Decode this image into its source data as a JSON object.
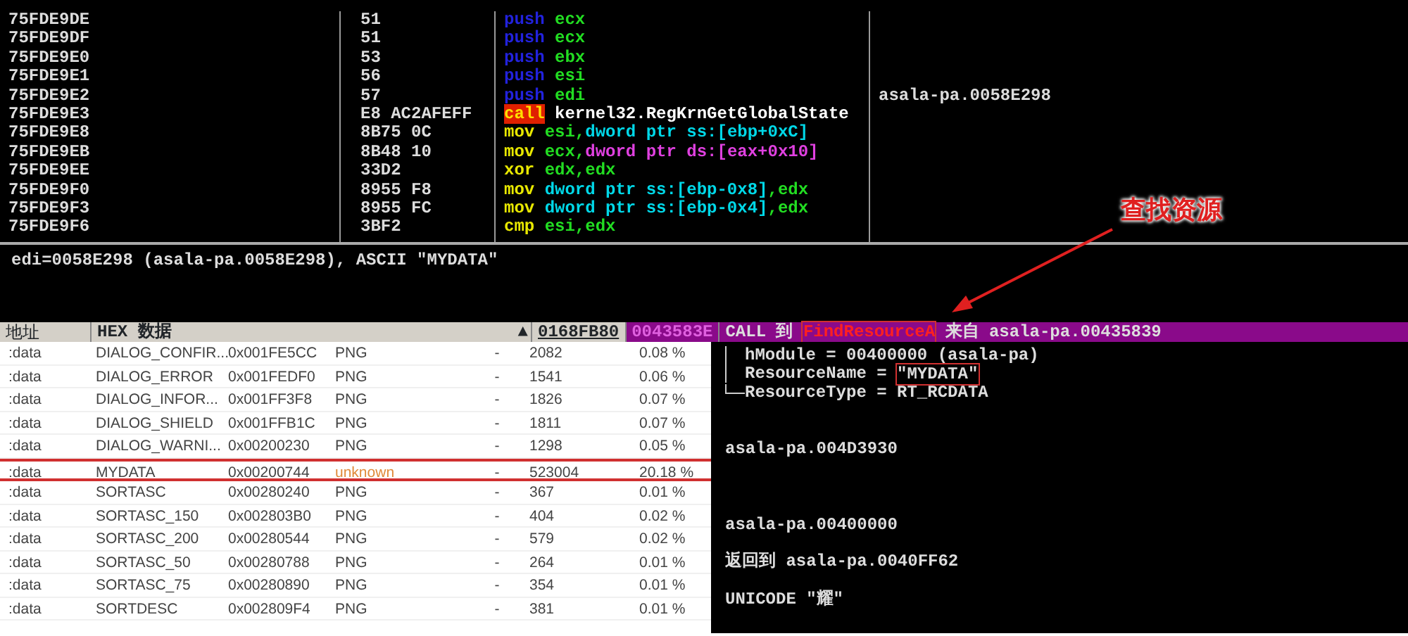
{
  "disassembly": [
    {
      "address": "75FDE9DE",
      "hex": "51",
      "mnemonic": {
        "text": "push",
        "kind": "push"
      },
      "operands": [
        {
          "text": "ecx",
          "kind": "reg"
        }
      ]
    },
    {
      "address": "75FDE9DF",
      "hex": "51",
      "mnemonic": {
        "text": "push",
        "kind": "push"
      },
      "operands": [
        {
          "text": "ecx",
          "kind": "reg"
        }
      ]
    },
    {
      "address": "75FDE9E0",
      "hex": "53",
      "mnemonic": {
        "text": "push",
        "kind": "push"
      },
      "operands": [
        {
          "text": "ebx",
          "kind": "reg"
        }
      ]
    },
    {
      "address": "75FDE9E1",
      "hex": "56",
      "mnemonic": {
        "text": "push",
        "kind": "push"
      },
      "operands": [
        {
          "text": "esi",
          "kind": "reg"
        }
      ]
    },
    {
      "address": "75FDE9E2",
      "hex": "57",
      "mnemonic": {
        "text": "push",
        "kind": "push"
      },
      "operands": [
        {
          "text": "edi",
          "kind": "reg"
        }
      ],
      "comment": "asala-pa.0058E298"
    },
    {
      "address": "75FDE9E3",
      "hex": "E8 AC2AFEFF",
      "mnemonic": {
        "text": "call",
        "kind": "call"
      },
      "operands": [
        {
          "text": "kernel32.RegKrnGetGlobalState",
          "kind": "sym"
        }
      ]
    },
    {
      "address": "75FDE9E8",
      "hex": "8B75 0C",
      "mnemonic": {
        "text": "mov",
        "kind": "op"
      },
      "operands": [
        {
          "text": "esi,",
          "kind": "reg"
        },
        {
          "text": "dword ptr ss:[ebp+0xC]",
          "kind": "mem"
        }
      ]
    },
    {
      "address": "75FDE9EB",
      "hex": "8B48 10",
      "mnemonic": {
        "text": "mov",
        "kind": "op"
      },
      "operands": [
        {
          "text": "ecx,",
          "kind": "reg"
        },
        {
          "text": "dword ptr ds:[eax+0x10]",
          "kind": "ds"
        }
      ]
    },
    {
      "address": "75FDE9EE",
      "hex": "33D2",
      "mnemonic": {
        "text": "xor",
        "kind": "op"
      },
      "operands": [
        {
          "text": "edx,edx",
          "kind": "reg"
        }
      ]
    },
    {
      "address": "75FDE9F0",
      "hex": "8955 F8",
      "mnemonic": {
        "text": "mov",
        "kind": "op"
      },
      "operands": [
        {
          "text": "dword ptr ss:[ebp-0x8]",
          "kind": "mem"
        },
        {
          "text": ",edx",
          "kind": "reg"
        }
      ]
    },
    {
      "address": "75FDE9F3",
      "hex": "8955 FC",
      "mnemonic": {
        "text": "mov",
        "kind": "op"
      },
      "operands": [
        {
          "text": "dword ptr ss:[ebp-0x4]",
          "kind": "mem"
        },
        {
          "text": ",edx",
          "kind": "reg"
        }
      ]
    },
    {
      "address": "75FDE9F6",
      "hex": "3BF2",
      "mnemonic": {
        "text": "cmp",
        "kind": "op"
      },
      "operands": [
        {
          "text": "esi,edx",
          "kind": "reg"
        }
      ]
    }
  ],
  "info_line": "edi=0058E298 (asala-pa.0058E298), ASCII \"MYDATA\"",
  "annotation": {
    "text": "查找资源"
  },
  "dump_header": {
    "address_label": "地址",
    "data_label": "HEX 数据",
    "scroll_arrow": "▲"
  },
  "stack_header": {
    "address": "0168FB80",
    "value": "0043583E",
    "call_prefix": "CALL 到",
    "function": "FindResourceA",
    "function_boxed": true,
    "call_suffix": "来自 asala-pa.00435839"
  },
  "stack_rows": [
    {
      "kind": "arg",
      "name": "hModule =",
      "value": "00400000 (asala-pa)",
      "boxed": false
    },
    {
      "kind": "arg",
      "name": "ResourceName =",
      "value": "\"MYDATA\"",
      "boxed": true
    },
    {
      "kind": "arg",
      "name": "ResourceType =",
      "value": "RT_RCDATA",
      "boxed": false
    },
    {
      "kind": "blank"
    },
    {
      "kind": "blank"
    },
    {
      "kind": "text",
      "text": "asala-pa.004D3930"
    },
    {
      "kind": "blank"
    },
    {
      "kind": "blank"
    },
    {
      "kind": "blank"
    },
    {
      "kind": "text",
      "text": "asala-pa.00400000"
    },
    {
      "kind": "blank"
    },
    {
      "kind": "text",
      "text": "返回到 asala-pa.0040FF62"
    },
    {
      "kind": "blank"
    },
    {
      "kind": "text",
      "text": "UNICODE \"耀\""
    }
  ],
  "resources": [
    {
      "section": ":data",
      "name": "DIALOG_CONFIR...",
      "offset": "0x001FE5CC",
      "type": "PNG",
      "type_known": true,
      "column_5": "-",
      "size": "2082",
      "percent": "0.08 %",
      "marked": false
    },
    {
      "section": ":data",
      "name": "DIALOG_ERROR",
      "offset": "0x001FEDF0",
      "type": "PNG",
      "type_known": true,
      "column_5": "-",
      "size": "1541",
      "percent": "0.06 %",
      "marked": false
    },
    {
      "section": ":data",
      "name": "DIALOG_INFOR...",
      "offset": "0x001FF3F8",
      "type": "PNG",
      "type_known": true,
      "column_5": "-",
      "size": "1826",
      "percent": "0.07 %",
      "marked": false
    },
    {
      "section": ":data",
      "name": "DIALOG_SHIELD",
      "offset": "0x001FFB1C",
      "type": "PNG",
      "type_known": true,
      "column_5": "-",
      "size": "1811",
      "percent": "0.07 %",
      "marked": false
    },
    {
      "section": ":data",
      "name": "DIALOG_WARNI...",
      "offset": "0x00200230",
      "type": "PNG",
      "type_known": true,
      "column_5": "-",
      "size": "1298",
      "percent": "0.05 %",
      "marked": false
    },
    {
      "section": ":data",
      "name": "MYDATA",
      "offset": "0x00200744",
      "type": "unknown",
      "type_known": false,
      "column_5": "-",
      "size": "523004",
      "percent": "20.18 %",
      "marked": true
    },
    {
      "section": ":data",
      "name": "SORTASC",
      "offset": "0x00280240",
      "type": "PNG",
      "type_known": true,
      "column_5": "-",
      "size": "367",
      "percent": "0.01 %",
      "marked": false
    },
    {
      "section": ":data",
      "name": "SORTASC_150",
      "offset": "0x002803B0",
      "type": "PNG",
      "type_known": true,
      "column_5": "-",
      "size": "404",
      "percent": "0.02 %",
      "marked": false
    },
    {
      "section": ":data",
      "name": "SORTASC_200",
      "offset": "0x00280544",
      "type": "PNG",
      "type_known": true,
      "column_5": "-",
      "size": "579",
      "percent": "0.02 %",
      "marked": false
    },
    {
      "section": ":data",
      "name": "SORTASC_50",
      "offset": "0x00280788",
      "type": "PNG",
      "type_known": true,
      "column_5": "-",
      "size": "264",
      "percent": "0.01 %",
      "marked": false
    },
    {
      "section": ":data",
      "name": "SORTASC_75",
      "offset": "0x00280890",
      "type": "PNG",
      "type_known": true,
      "column_5": "-",
      "size": "354",
      "percent": "0.01 %",
      "marked": false
    },
    {
      "section": ":data",
      "name": "SORTDESC",
      "offset": "0x002809F4",
      "type": "PNG",
      "type_known": true,
      "column_5": "-",
      "size": "381",
      "percent": "0.01 %",
      "marked": false
    }
  ]
}
